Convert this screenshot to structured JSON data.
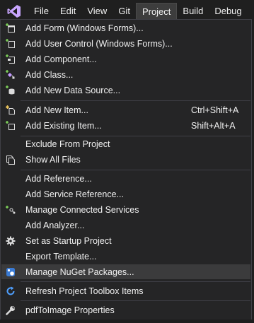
{
  "menubar": {
    "logo_icon": "visual-studio-logo",
    "items": [
      {
        "label": "File"
      },
      {
        "label": "Edit"
      },
      {
        "label": "View"
      },
      {
        "label": "Git"
      },
      {
        "label": "Project"
      },
      {
        "label": "Build"
      },
      {
        "label": "Debug"
      }
    ],
    "active": "Project"
  },
  "menu": {
    "items": [
      {
        "label": "Add Form (Windows Forms)...",
        "icon": "add-form-icon"
      },
      {
        "label": "Add User Control (Windows Forms)...",
        "icon": "add-user-control-icon"
      },
      {
        "label": "Add Component...",
        "icon": "add-component-icon"
      },
      {
        "label": "Add Class...",
        "icon": "add-class-icon"
      },
      {
        "label": "Add New Data Source...",
        "icon": "add-data-source-icon"
      },
      {
        "label": "Add New Item...",
        "shortcut": "Ctrl+Shift+A",
        "icon": "add-new-item-icon"
      },
      {
        "label": "Add Existing Item...",
        "shortcut": "Shift+Alt+A",
        "icon": "add-existing-item-icon"
      },
      {
        "label": "Exclude From Project",
        "icon": ""
      },
      {
        "label": "Show All Files",
        "icon": "show-all-files-icon"
      },
      {
        "label": "Add Reference...",
        "icon": ""
      },
      {
        "label": "Add Service Reference...",
        "icon": ""
      },
      {
        "label": "Manage Connected Services",
        "icon": "connected-services-icon"
      },
      {
        "label": "Add Analyzer...",
        "icon": ""
      },
      {
        "label": "Set as Startup Project",
        "icon": "gear-icon"
      },
      {
        "label": "Export Template...",
        "icon": ""
      },
      {
        "label": "Manage NuGet Packages...",
        "icon": "nuget-icon"
      },
      {
        "label": "Refresh Project Toolbox Items",
        "icon": "refresh-icon"
      },
      {
        "label": "pdfToImage Properties",
        "icon": "wrench-icon"
      }
    ],
    "highlighted_index": 15
  }
}
